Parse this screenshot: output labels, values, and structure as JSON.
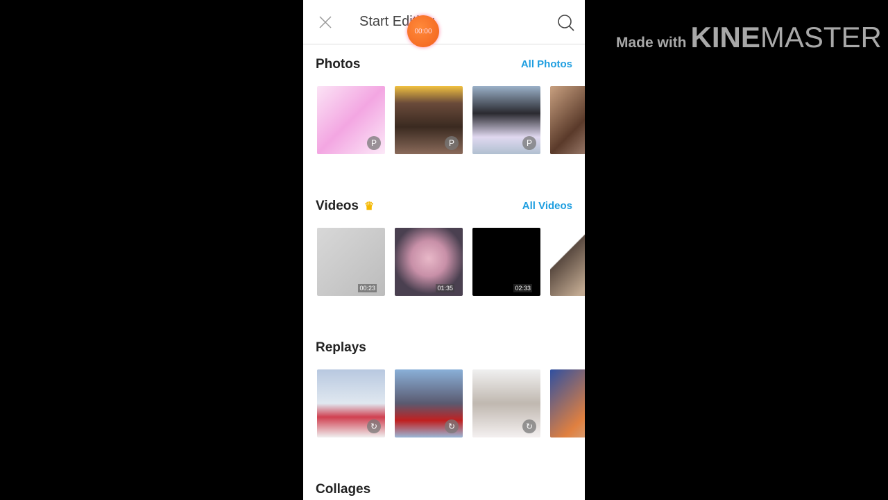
{
  "header": {
    "title": "Start Editing",
    "recording_timer": "00:00"
  },
  "sections": {
    "photos": {
      "title": "Photos",
      "link": "All Photos"
    },
    "videos": {
      "title": "Videos",
      "link": "All Videos",
      "durations": [
        "00:23",
        "01:35",
        "02:33"
      ]
    },
    "replays": {
      "title": "Replays"
    },
    "collages": {
      "title": "Collages"
    }
  },
  "watermark": {
    "made_with": "Made with",
    "brand_bold": "KINE",
    "brand_light": "MASTER"
  },
  "colors": {
    "accent": "#1e9ee0",
    "recording": "#f2601c",
    "premium": "#f5b800"
  }
}
